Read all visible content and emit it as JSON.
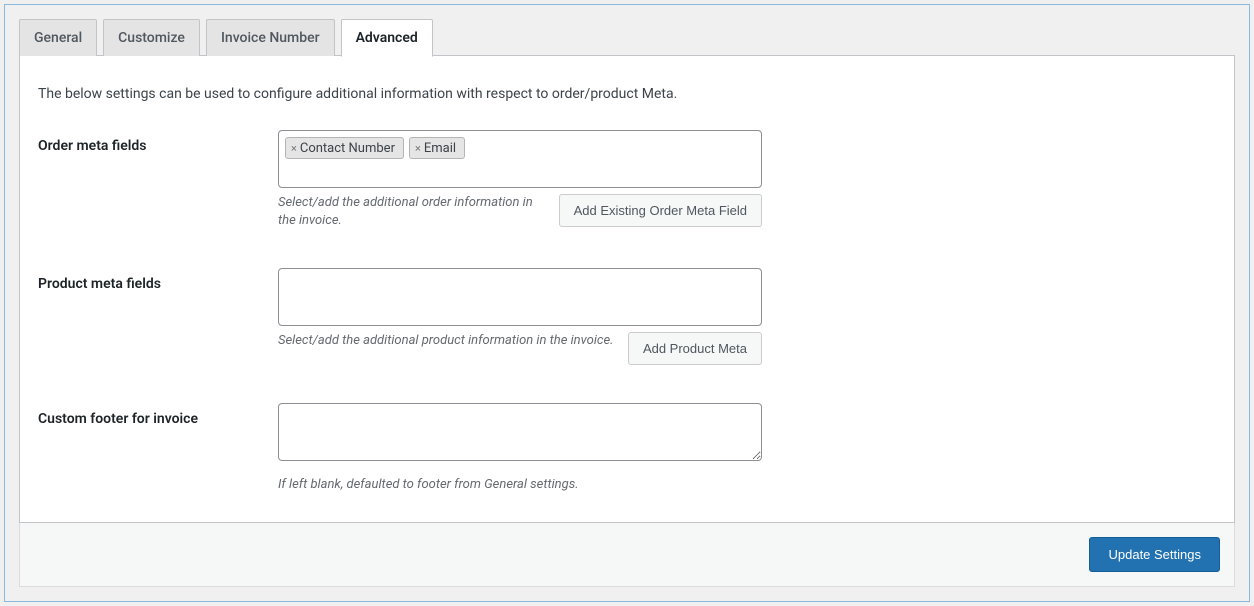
{
  "tabs": {
    "general": "General",
    "customize": "Customize",
    "invoice_number": "Invoice Number",
    "advanced": "Advanced"
  },
  "intro": "The below settings can be used to configure additional information with respect to order/product Meta.",
  "order_meta": {
    "label": "Order meta fields",
    "tags": [
      "Contact Number",
      "Email"
    ],
    "help": "Select/add the additional order information in the invoice.",
    "button": "Add Existing Order Meta Field"
  },
  "product_meta": {
    "label": "Product meta fields",
    "help": "Select/add the additional product information in the invoice.",
    "button": "Add Product Meta"
  },
  "custom_footer": {
    "label": "Custom footer for invoice",
    "value": "",
    "help": "If left blank, defaulted to footer from General settings."
  },
  "actions": {
    "update": "Update Settings"
  }
}
